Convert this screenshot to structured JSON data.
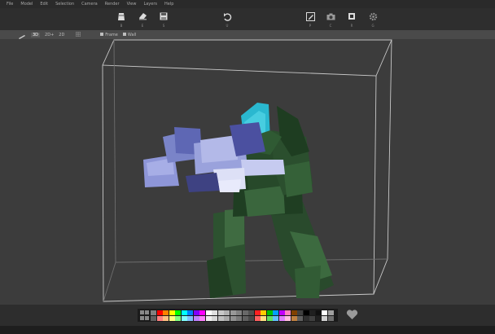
{
  "menubar": {
    "items": [
      "File",
      "Model",
      "Edit",
      "Selection",
      "Camera",
      "Render",
      "View",
      "Layers",
      "Help"
    ]
  },
  "toolbar": {
    "tools": [
      {
        "icon": "paint-bucket-icon",
        "label": "B"
      },
      {
        "icon": "eraser-icon",
        "label": "E"
      },
      {
        "icon": "save-icon",
        "label": "S"
      },
      {
        "icon": "undo-icon",
        "label": "U"
      },
      {
        "icon": "edit-pen-icon",
        "label": "P"
      },
      {
        "icon": "camera-icon",
        "label": "C"
      },
      {
        "icon": "crop-icon",
        "label": "R"
      },
      {
        "icon": "settings-gear-icon",
        "label": "G"
      }
    ]
  },
  "viewbar": {
    "view_3d": "3D",
    "view_2d5": "2D+",
    "view_2d": "2D",
    "frame_label": "Frame",
    "wall_label": "Wall"
  },
  "colors": {
    "background": "#3c3c3c",
    "toolbar": "#2e2e2e",
    "wireframe": "#cfcfcf",
    "soldier_green_dark": "#1e3d21",
    "soldier_green_mid": "#2f5a33",
    "soldier_green_light": "#4b7a4e",
    "helmet_cyan": "#2ab8d0",
    "gun_blue_light": "#9ea6e0",
    "gun_blue_mid": "#7a84c8",
    "gun_blue_dark": "#4a4e98"
  },
  "palette": {
    "row1": [
      "#808080",
      "#ff0000",
      "#ff8000",
      "#ffff00",
      "#00ff00",
      "#00ffff",
      "#0080ff",
      "#8000ff",
      "#ff00ff",
      "#ffffff",
      "#e0e0e0",
      "#c8c8c8",
      "#b0b0b0",
      "#989898",
      "#808080",
      "#686868",
      "#505050",
      "#ff2020",
      "#ffcc00",
      "#00c000",
      "#00a0ff",
      "#c000ff",
      "#ff80c0",
      "#804000",
      "#404040",
      "#000000",
      "#202020",
      "#101010",
      "#ffffff",
      "#a0a0a0"
    ],
    "row2": [
      "#606060",
      "#ff8080",
      "#ffc080",
      "#ffff80",
      "#80ff80",
      "#80ffff",
      "#80c0ff",
      "#c080ff",
      "#ff80ff",
      "#f0f0f0",
      "#d8d8d8",
      "#c0c0c0",
      "#a8a8a8",
      "#909090",
      "#787878",
      "#606060",
      "#484848",
      "#ff6060",
      "#ffe080",
      "#60e060",
      "#60c0ff",
      "#e080ff",
      "#ffc0e0",
      "#c08040",
      "#606060",
      "#303030",
      "#404040",
      "#202020",
      "#d0d0d0",
      "#707070"
    ]
  },
  "favorite": {
    "icon": "heart-icon"
  }
}
